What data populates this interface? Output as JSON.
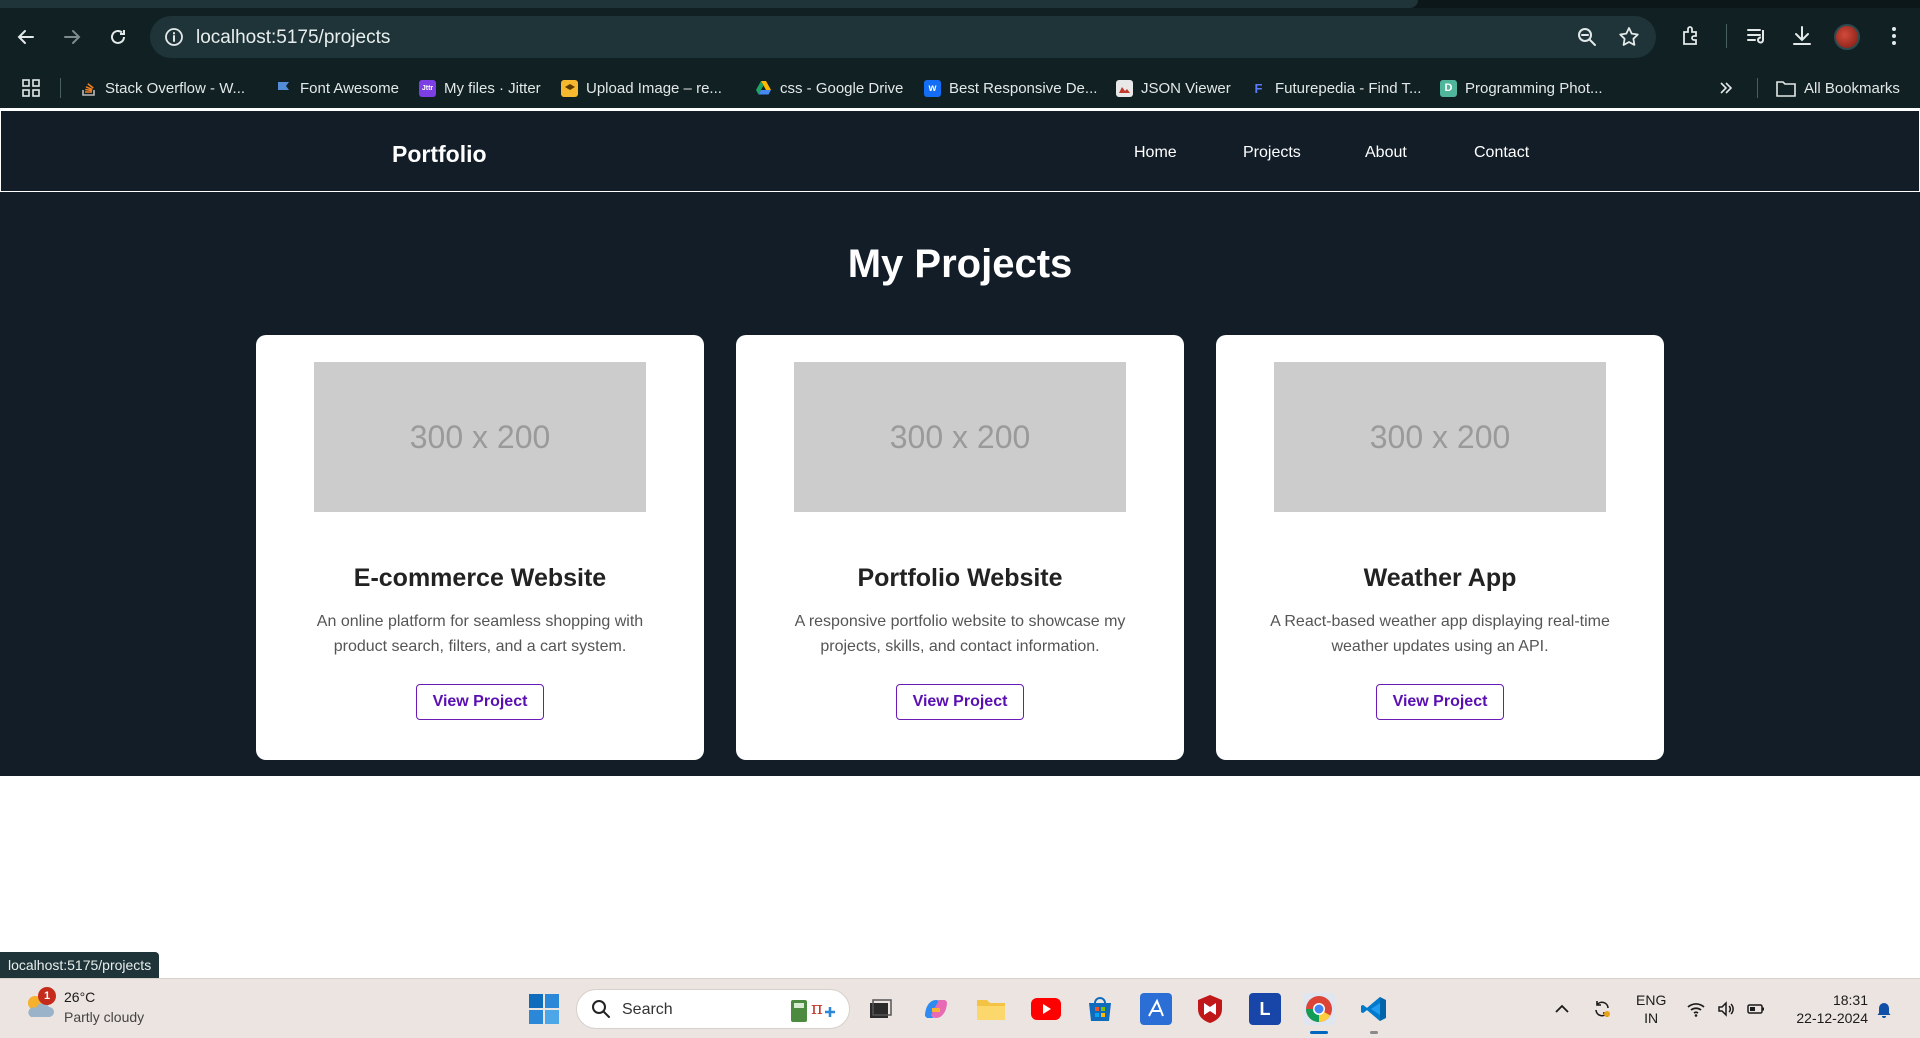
{
  "browser": {
    "url": "localhost:5175/projects",
    "bookmarks": [
      {
        "label": "Stack Overflow - W...",
        "icon": "stackoverflow-icon",
        "color": "#f48024"
      },
      {
        "label": "Font Awesome",
        "icon": "flag-icon",
        "color": "#538dd7"
      },
      {
        "label": "My files · Jitter",
        "icon": "jitter-icon",
        "color": "#7b3fe4"
      },
      {
        "label": "Upload Image – re...",
        "icon": "upload-image-icon",
        "color": "#f5b82e"
      },
      {
        "label": "css - Google Drive",
        "icon": "google-drive-icon",
        "color": "#1fa463"
      },
      {
        "label": "Best Responsive De...",
        "icon": "webflow-icon",
        "color": "#146ef5"
      },
      {
        "label": "JSON Viewer",
        "icon": "json-viewer-icon",
        "color": "#e8e8e8"
      },
      {
        "label": "Futurepedia - Find T...",
        "icon": "futurepedia-icon",
        "color": "#3b5bfd"
      },
      {
        "label": "Programming Phot...",
        "icon": "dribbble-icon",
        "color": "#4fb59b"
      }
    ],
    "all_bookmarks_label": "All Bookmarks",
    "status_link": "localhost:5175/projects"
  },
  "site": {
    "brand": "Portfolio",
    "nav": [
      "Home",
      "Projects",
      "About",
      "Contact"
    ],
    "heading": "My Projects",
    "projects": [
      {
        "image_text": "300 x 200",
        "title": "E-commerce Website",
        "description": "An online platform for seamless shopping with product search, filters, and a cart system.",
        "button": "View Project"
      },
      {
        "image_text": "300 x 200",
        "title": "Portfolio Website",
        "description": "A responsive portfolio website to showcase my projects, skills, and contact information.",
        "button": "View Project"
      },
      {
        "image_text": "300 x 200",
        "title": "Weather App",
        "description": "A React-based weather app displaying real-time weather updates using an API.",
        "button": "View Project"
      }
    ]
  },
  "taskbar": {
    "weather_badge": "1",
    "temperature": "26°C",
    "condition": "Partly cloudy",
    "search_label": "Search",
    "lang_line1": "ENG",
    "lang_line2": "IN",
    "time": "18:31",
    "date": "22-12-2024"
  },
  "colors": {
    "page_dark": "#121d27",
    "accent_purple": "#5a0fb0",
    "chrome_bg": "#102023"
  }
}
